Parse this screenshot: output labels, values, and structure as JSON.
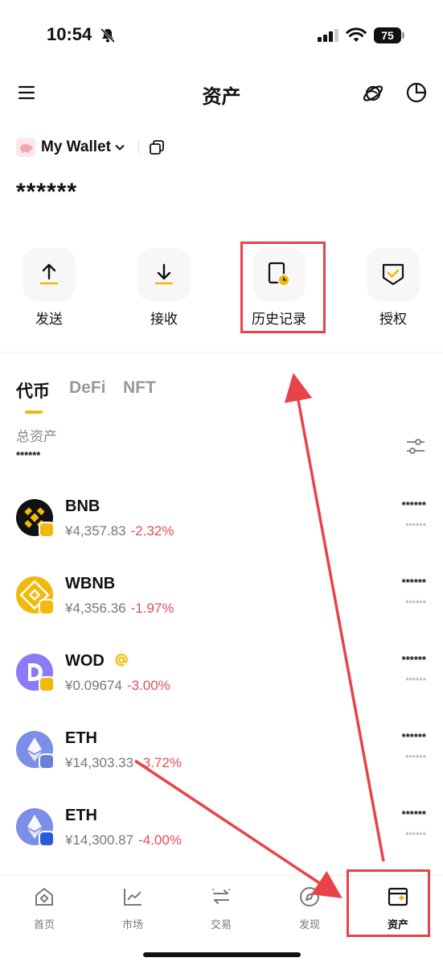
{
  "status_bar": {
    "time": "10:54",
    "battery": "75"
  },
  "header": {
    "title": "资产"
  },
  "wallet": {
    "name": "My Wallet",
    "balance": "******"
  },
  "actions": [
    {
      "label": "发送",
      "icon": "send-up-arrow-icon"
    },
    {
      "label": "接收",
      "icon": "receive-down-arrow-icon"
    },
    {
      "label": "历史记录",
      "icon": "history-clock-icon"
    },
    {
      "label": "授权",
      "icon": "authorize-shield-icon"
    }
  ],
  "tabs": [
    "代币",
    "DeFi",
    "NFT"
  ],
  "total": {
    "label": "总资产",
    "value": "******"
  },
  "tokens": [
    {
      "symbol": "BNB",
      "price": "¥4,357.83",
      "change": "-2.32%",
      "amount": "******",
      "fiat": "******"
    },
    {
      "symbol": "WBNB",
      "price": "¥4,356.36",
      "change": "-1.97%",
      "amount": "******",
      "fiat": "******"
    },
    {
      "symbol": "WOD",
      "price": "¥0.09674",
      "change": "-3.00%",
      "amount": "******",
      "fiat": "******"
    },
    {
      "symbol": "ETH",
      "price": "¥14,303.33",
      "change": "-3.72%",
      "amount": "******",
      "fiat": "******"
    },
    {
      "symbol": "ETH",
      "price": "¥14,300.87",
      "change": "-4.00%",
      "amount": "******",
      "fiat": "******"
    }
  ],
  "bottom_nav": [
    {
      "label": "首页",
      "icon": "home-icon"
    },
    {
      "label": "市场",
      "icon": "market-chart-icon"
    },
    {
      "label": "交易",
      "icon": "swap-icon"
    },
    {
      "label": "发现",
      "icon": "discover-compass-icon"
    },
    {
      "label": "资产",
      "icon": "wallet-icon",
      "active": true
    }
  ],
  "colors": {
    "brand": "#f0b90b",
    "negative": "#e14d5a",
    "annotation": "#e8434b"
  }
}
